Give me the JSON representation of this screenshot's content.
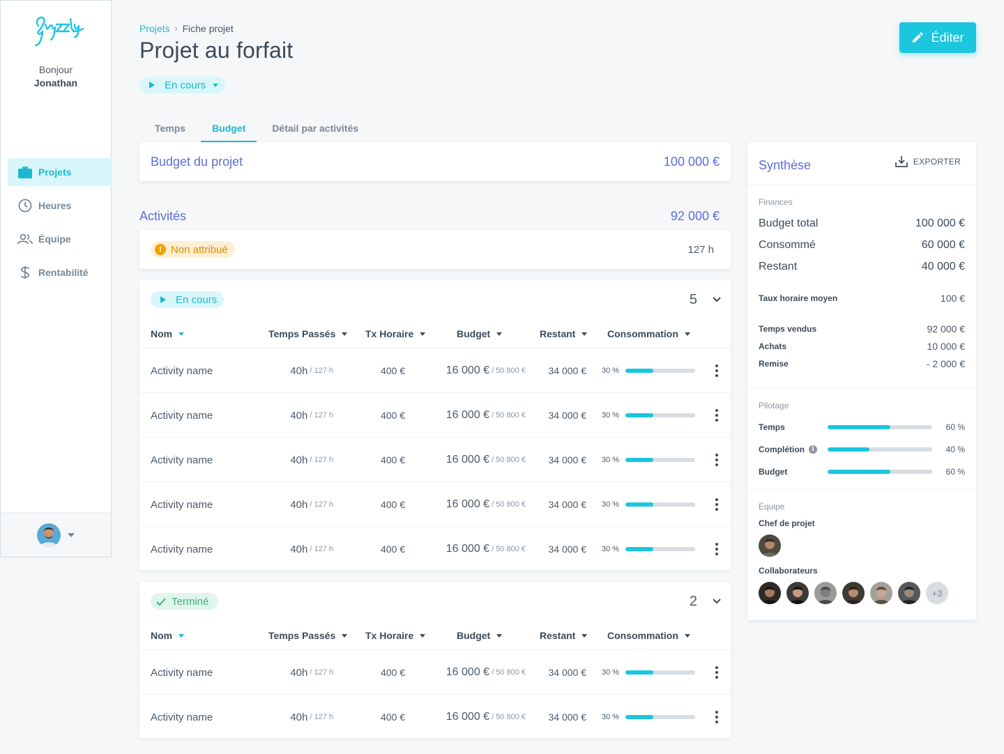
{
  "app": {
    "logo_text": "Gryzzly"
  },
  "sidebar": {
    "greeting": "Bonjour",
    "user_name": "Jonathan",
    "items": [
      {
        "label": "Projets",
        "icon": "briefcase-icon",
        "active": true
      },
      {
        "label": "Heures",
        "icon": "clock-icon",
        "active": false
      },
      {
        "label": "Équipe",
        "icon": "team-icon",
        "active": false
      },
      {
        "label": "Rentabilité",
        "icon": "dollar-icon",
        "active": false
      }
    ]
  },
  "header": {
    "breadcrumb": [
      "Projets",
      "Fiche projet"
    ],
    "title": "Projet au forfait",
    "status": "En cours",
    "edit_label": "Éditer"
  },
  "tabs": [
    "Temps",
    "Budget",
    "Détail par activités"
  ],
  "active_tab": "Budget",
  "budget": {
    "label": "Budget du projet",
    "value": "100 000 €"
  },
  "activities": {
    "label": "Activités",
    "total": "92 000 €",
    "unassigned": {
      "label": "Non attribué",
      "hours": "127 h"
    }
  },
  "columns": [
    "Nom",
    "Temps Passés",
    "Tx Horaire",
    "Budget",
    "Restant",
    "Consommation"
  ],
  "groups": [
    {
      "status": "En cours",
      "count": "5",
      "rows": [
        {
          "name": "Activity name",
          "time": "40h",
          "time_total": "/ 127 h",
          "rate": "400 €",
          "budget": "16 000 €",
          "budget_total": "/ 50 800 €",
          "remaining": "34 000 €",
          "consumption_label": "30 %",
          "consumption": 0.4
        },
        {
          "name": "Activity name",
          "time": "40h",
          "time_total": "/ 127 h",
          "rate": "400 €",
          "budget": "16 000 €",
          "budget_total": "/ 50 800 €",
          "remaining": "34 000 €",
          "consumption_label": "30 %",
          "consumption": 0.4
        },
        {
          "name": "Activity name",
          "time": "40h",
          "time_total": "/ 127 h",
          "rate": "400 €",
          "budget": "16 000 €",
          "budget_total": "/ 50 800 €",
          "remaining": "34 000 €",
          "consumption_label": "30 %",
          "consumption": 0.4
        },
        {
          "name": "Activity name",
          "time": "40h",
          "time_total": "/ 127 h",
          "rate": "400 €",
          "budget": "16 000 €",
          "budget_total": "/ 50 800 €",
          "remaining": "34 000 €",
          "consumption_label": "30 %",
          "consumption": 0.4
        },
        {
          "name": "Activity name",
          "time": "40h",
          "time_total": "/ 127 h",
          "rate": "400 €",
          "budget": "16 000 €",
          "budget_total": "/ 50 800 €",
          "remaining": "34 000 €",
          "consumption_label": "30 %",
          "consumption": 0.4
        }
      ]
    },
    {
      "status": "Terminé",
      "count": "2",
      "rows": [
        {
          "name": "Activity name",
          "time": "40h",
          "time_total": "/ 127 h",
          "rate": "400 €",
          "budget": "16 000 €",
          "budget_total": "/ 50 800 €",
          "remaining": "34 000 €",
          "consumption_label": "30 %",
          "consumption": 0.4
        },
        {
          "name": "Activity name",
          "time": "40h",
          "time_total": "/ 127 h",
          "rate": "400 €",
          "budget": "16 000 €",
          "budget_total": "/ 50 800 €",
          "remaining": "34 000 €",
          "consumption_label": "30 %",
          "consumption": 0.4
        }
      ]
    }
  ],
  "synthese": {
    "title": "Synthèse",
    "export_label": "EXPORTER",
    "finances_label": "Finances",
    "budget_total_label": "Budget total",
    "budget_total": "100 000 €",
    "consumed_label": "Consommé",
    "consumed": "60 000 €",
    "remaining_label": "Restant",
    "remaining": "40 000 €",
    "avg_rate_label": "Taux horaire moyen",
    "avg_rate": "100 €",
    "sold_label": "Temps vendus",
    "sold": "92 000 €",
    "purchases_label": "Achats",
    "purchases": "10 000 €",
    "discount_label": "Remise",
    "discount": "- 2 000 €",
    "pilotage_label": "Pilotage",
    "pilotage": [
      {
        "label": "Temps",
        "value_label": "60 %",
        "value": 0.6,
        "info": false
      },
      {
        "label": "Complétion",
        "value_label": "40 %",
        "value": 0.4,
        "info": true
      },
      {
        "label": "Budget",
        "value_label": "60 %",
        "value": 0.6,
        "info": false
      }
    ],
    "team_label": "Équipe",
    "lead_label": "Chef de projet",
    "collab_label": "Collaborateurs",
    "more_collabs": "+3"
  },
  "colors": {
    "accent": "#1bc6de",
    "purple": "#5c6fd6",
    "warning": "#f2a000",
    "success": "#36b37e"
  }
}
